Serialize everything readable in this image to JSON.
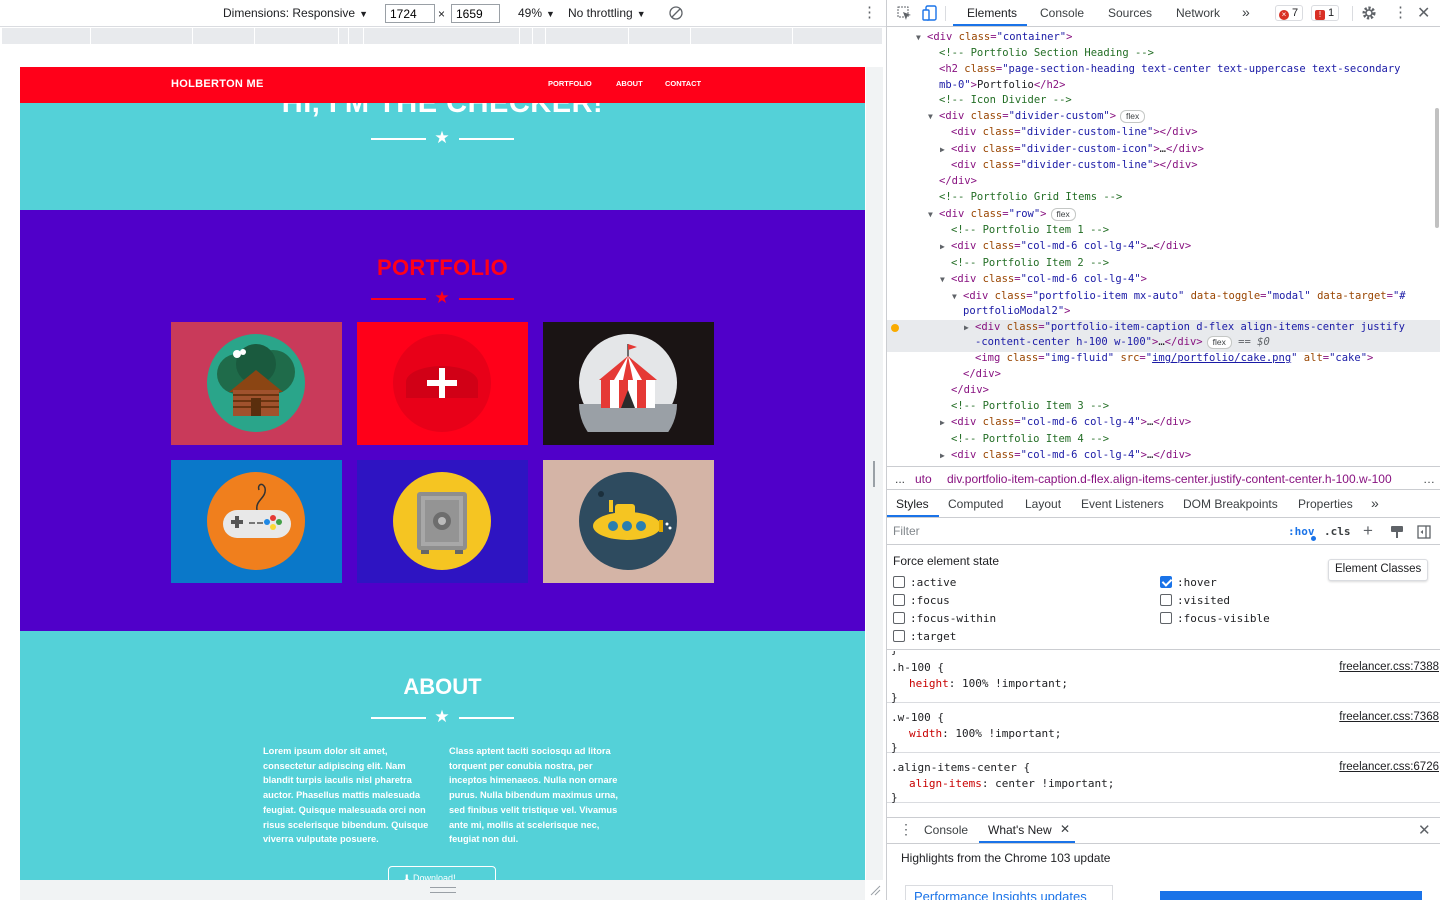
{
  "device_toolbar": {
    "dimensions_label": "Dimensions: Responsive",
    "width_value": "1724",
    "times": "×",
    "height_value": "1659",
    "zoom": "49%",
    "throttling": "No throttling",
    "caret": "▼",
    "more": "⋮"
  },
  "site": {
    "brand": "HOLBERTON ME",
    "nav_links": [
      "PORTFOLIO",
      "ABOUT",
      "CONTACT"
    ],
    "masthead_heading": "HI, I'M THE CHECKER!",
    "star": "★",
    "portfolio_title": "PORTFOLIO",
    "portfolio_items": [
      {
        "name": "cabin",
        "bg": "#c93a5a"
      },
      {
        "name": "cake",
        "bg": "#ff0019"
      },
      {
        "name": "circus",
        "bg": "#1a1414"
      },
      {
        "name": "game",
        "bg": "#0a78c9"
      },
      {
        "name": "safe",
        "bg": "#2e14c2"
      },
      {
        "name": "submarine",
        "bg": "#d4b4a6"
      }
    ],
    "about_title": "ABOUT",
    "about_left": "Lorem ipsum dolor sit amet, consectetur adipiscing elit. Nam blandit turpis iaculis nisl pharetra auctor. Phasellus mattis malesuada feugiat. Quisque malesuada orci non risus scelerisque bibendum. Quisque viverra vulputate posuere.",
    "about_right": "Class aptent taciti sociosqu ad litora torquent per conubia nostra, per inceptos himenaeos. Nulla non ornare purus. Nulla bibendum maximus urna, sed finibus velit tristique vel. Vivamus ante mi, mollis at scelerisque nec, feugiat non dui.",
    "download_label": "⬇ Download!",
    "colors": {
      "nav": "#ff0019",
      "primary": "#54d1d8",
      "portfolio_bg": "#5000c9"
    }
  },
  "devtools": {
    "tabs": [
      "Elements",
      "Console",
      "Sources",
      "Network"
    ],
    "more_tabs": "»",
    "error_count": "7",
    "warning_count": "1",
    "dom_lines": [
      {
        "indent": 3,
        "tri": "▼",
        "html": "<span class='tg'>&lt;div</span> <span class='an'>class</span>=<span class='av'>\"container\"</span><span class='tg'>&gt;</span>"
      },
      {
        "indent": 4,
        "tri": "",
        "html": "<span class='cm'>&lt;!-- Portfolio Section Heading --&gt;</span>"
      },
      {
        "indent": 4,
        "tri": "",
        "html": "<span class='tg'>&lt;h2</span> <span class='an'>class</span>=<span class='av'>\"page-section-heading text-center text-uppercase text-secondary</span>"
      },
      {
        "indent": 4,
        "tri": "",
        "html": "<span class='av'>mb-0\"</span><span class='tg'>&gt;</span><span class='txt'>Portfolio</span><span class='tg'>&lt;/h2&gt;</span>"
      },
      {
        "indent": 4,
        "tri": "",
        "html": "<span class='cm'>&lt;!-- Icon Divider --&gt;</span>"
      },
      {
        "indent": 4,
        "tri": "▼",
        "html": "<span class='tg'>&lt;div</span> <span class='an'>class</span>=<span class='av'>\"divider-custom\"</span><span class='tg'>&gt;</span><span class='pill'>flex</span>"
      },
      {
        "indent": 5,
        "tri": "",
        "html": "<span class='tg'>&lt;div</span> <span class='an'>class</span>=<span class='av'>\"divider-custom-line\"</span><span class='tg'>&gt;&lt;/div&gt;</span>"
      },
      {
        "indent": 5,
        "tri": "▶",
        "html": "<span class='tg'>&lt;div</span> <span class='an'>class</span>=<span class='av'>\"divider-custom-icon\"</span><span class='tg'>&gt;</span><span class='txt'>…</span><span class='tg'>&lt;/div&gt;</span>"
      },
      {
        "indent": 5,
        "tri": "",
        "html": "<span class='tg'>&lt;div</span> <span class='an'>class</span>=<span class='av'>\"divider-custom-line\"</span><span class='tg'>&gt;&lt;/div&gt;</span>"
      },
      {
        "indent": 4,
        "tri": "",
        "html": "<span class='tg'>&lt;/div&gt;</span>"
      },
      {
        "indent": 4,
        "tri": "",
        "html": "<span class='cm'>&lt;!-- Portfolio Grid Items --&gt;</span>"
      },
      {
        "indent": 4,
        "tri": "▼",
        "html": "<span class='tg'>&lt;div</span> <span class='an'>class</span>=<span class='av'>\"row\"</span><span class='tg'>&gt;</span><span class='pill'>flex</span>"
      },
      {
        "indent": 5,
        "tri": "",
        "html": "<span class='cm'>&lt;!-- Portfolio Item 1 --&gt;</span>"
      },
      {
        "indent": 5,
        "tri": "▶",
        "html": "<span class='tg'>&lt;div</span> <span class='an'>class</span>=<span class='av'>\"col-md-6 col-lg-4\"</span><span class='tg'>&gt;</span><span class='txt'>…</span><span class='tg'>&lt;/div&gt;</span>"
      },
      {
        "indent": 5,
        "tri": "",
        "html": "<span class='cm'>&lt;!-- Portfolio Item 2 --&gt;</span>"
      },
      {
        "indent": 5,
        "tri": "▼",
        "html": "<span class='tg'>&lt;div</span> <span class='an'>class</span>=<span class='av'>\"col-md-6 col-lg-4\"</span><span class='tg'>&gt;</span>"
      },
      {
        "indent": 6,
        "tri": "▼",
        "html": "<span class='tg'>&lt;div</span> <span class='an'>class</span>=<span class='av'>\"portfolio-item mx-auto\"</span> <span class='an'>data-toggle</span>=<span class='av'>\"modal\"</span> <span class='an'>data-target</span>=<span class='av'>\"#</span>"
      },
      {
        "indent": 6,
        "tri": "",
        "html": "<span class='av'>portfolioModal2\"</span><span class='tg'>&gt;</span>"
      },
      {
        "indent": 7,
        "tri": "▶",
        "html": "<span class='tg'>&lt;div</span> <span class='an'>class</span>=<span class='av'>\"portfolio-item-caption d-flex align-items-center justify</span>"
      },
      {
        "indent": 7,
        "tri": "",
        "html": "<span class='av'>-content-center h-100 w-100\"</span><span class='tg'>&gt;</span><span class='txt'>…</span><span class='tg'>&lt;/div&gt;</span><span class='pill'>flex</span> <span class='txt' style='color:#5f6368'>== <i>$0</i></span>"
      },
      {
        "indent": 7,
        "tri": "",
        "html": "<span class='tg'>&lt;img</span> <span class='an'>class</span>=<span class='av'>\"img-fluid\"</span> <span class='an'>src</span>=<span class='av'>\"</span><span class='lnk'>img/portfolio/cake.png</span><span class='av'>\"</span> <span class='an'>alt</span>=<span class='av'>\"cake\"</span><span class='tg'>&gt;</span>"
      },
      {
        "indent": 6,
        "tri": "",
        "html": "<span class='tg'>&lt;/div&gt;</span>"
      },
      {
        "indent": 5,
        "tri": "",
        "html": "<span class='tg'>&lt;/div&gt;</span>"
      },
      {
        "indent": 5,
        "tri": "",
        "html": "<span class='cm'>&lt;!-- Portfolio Item 3 --&gt;</span>"
      },
      {
        "indent": 5,
        "tri": "▶",
        "html": "<span class='tg'>&lt;div</span> <span class='an'>class</span>=<span class='av'>\"col-md-6 col-lg-4\"</span><span class='tg'>&gt;</span><span class='txt'>…</span><span class='tg'>&lt;/div&gt;</span>"
      },
      {
        "indent": 5,
        "tri": "",
        "html": "<span class='cm'>&lt;!-- Portfolio Item 4 --&gt;</span>"
      },
      {
        "indent": 5,
        "tri": "▶",
        "html": "<span class='tg'>&lt;div</span> <span class='an'>class</span>=<span class='av'>\"col-md-6 col-lg-4\"</span><span class='tg'>&gt;</span><span class='txt'>…</span><span class='tg'>&lt;/div&gt;</span>"
      }
    ],
    "breadcrumb_dots": "...",
    "breadcrumb_prev": "uto",
    "breadcrumb_current": "div.portfolio-item-caption.d-flex.align-items-center.justify-content-center.h-100.w-100",
    "breadcrumb_more": "…",
    "styles_tabs": [
      "Styles",
      "Computed",
      "Layout",
      "Event Listeners",
      "DOM Breakpoints",
      "Properties"
    ],
    "filter_placeholder": "Filter",
    "hov_label": ":hov",
    "cls_label": ".cls",
    "force_state_heading": "Force element state",
    "element_classes_label": "Element Classes",
    "states_left": [
      ":active",
      ":focus",
      ":focus-within",
      ":target"
    ],
    "states_right": [
      ":hover",
      ":visited",
      ":focus-visible"
    ],
    "checked_state": ":hover",
    "rules": [
      {
        "selector": ".h-100 {",
        "prop": "height",
        "value": "100% !important;",
        "source": "freelancer.css:7388"
      },
      {
        "selector": ".w-100 {",
        "prop": "width",
        "value": "100% !important;",
        "source": "freelancer.css:7368"
      },
      {
        "selector": ".align-items-center {",
        "prop": "align-items",
        "value": "center !important;",
        "source": "freelancer.css:6726"
      }
    ],
    "drawer_tabs": [
      "Console",
      "What's New"
    ],
    "drawer_highlight": "Highlights from the Chrome 103 update",
    "drawer_card": "Performance Insights updates"
  }
}
